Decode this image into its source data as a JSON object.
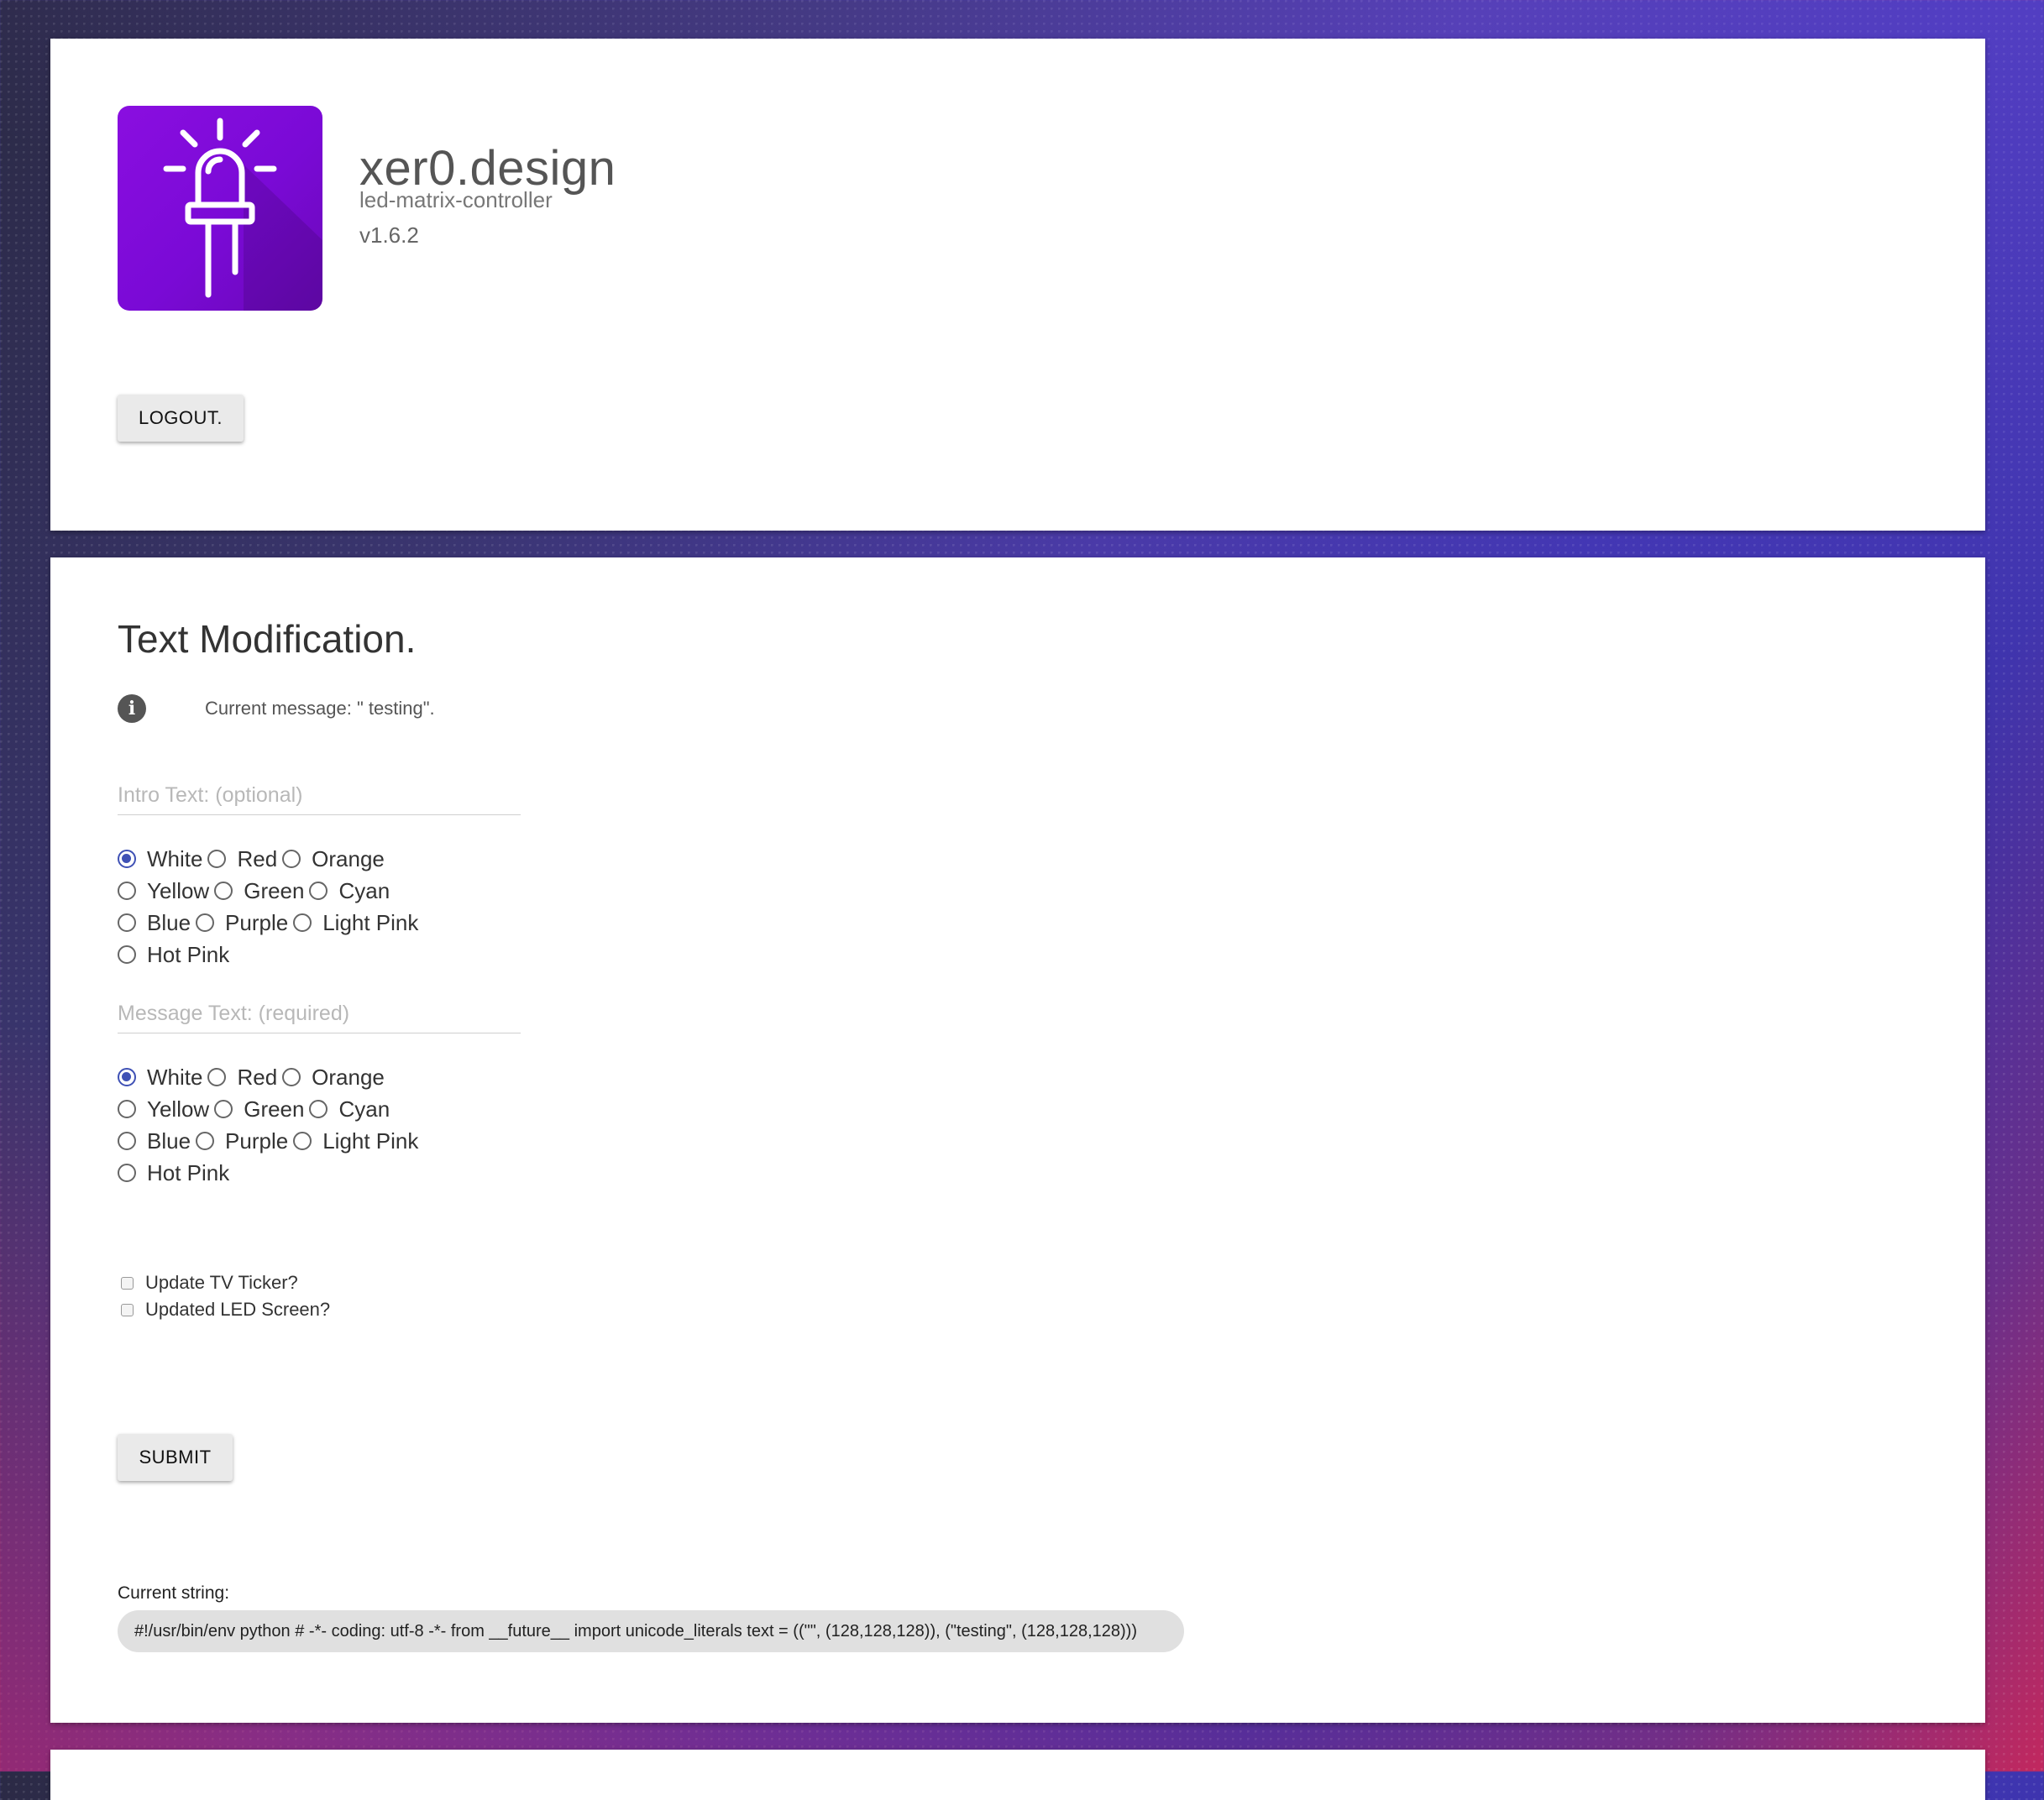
{
  "header": {
    "title": "xer0.design",
    "subtitle": "led-matrix-controller",
    "version": "v1.6.2",
    "logo_icon": "led-bulb-icon",
    "logo_color": "#8a0ee0",
    "logout_label": "LOGOUT."
  },
  "text_mod": {
    "title": "Text Modification.",
    "current_message": "Current message: \" testing\".",
    "intro": {
      "placeholder": "Intro Text: (optional)",
      "value": "",
      "selected_color": "White"
    },
    "message": {
      "placeholder": "Message Text: (required)",
      "value": "",
      "selected_color": "White"
    },
    "color_rows": [
      [
        "White",
        "Red",
        "Orange"
      ],
      [
        "Yellow",
        "Green",
        "Cyan"
      ],
      [
        "Blue",
        "Purple",
        "Light Pink"
      ],
      [
        "Hot Pink"
      ]
    ],
    "checkboxes": [
      {
        "label": "Update TV Ticker?",
        "checked": false
      },
      {
        "label": "Updated LED Screen?",
        "checked": false
      }
    ],
    "submit_label": "SUBMIT",
    "current_string_label": "Current string:",
    "current_string": "#!/usr/bin/env python # -*- coding: utf-8 -*- from __future__ import unicode_literals text = ((\"\", (128,128,128)), (\"testing\", (128,128,128)))"
  },
  "accent_color": "#3f51b5"
}
